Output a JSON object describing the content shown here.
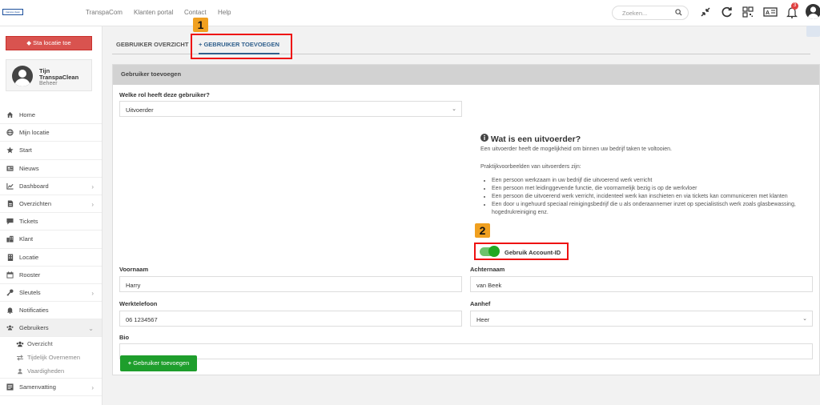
{
  "topbar": {
    "logo_text": "transpa clean",
    "nav": [
      "TranspaCom",
      "Klanten portal",
      "Contact",
      "Help"
    ],
    "search_placeholder": "Zoeken...",
    "notification_count": "3"
  },
  "sidebar": {
    "sta_button": "Sta locatie toe",
    "user": {
      "line1": "Tijn",
      "line2": "TranspaClean",
      "role": "Beheer"
    },
    "items": [
      {
        "label": "Home",
        "icon": "home-icon"
      },
      {
        "label": "Mijn locatie",
        "icon": "globe-icon"
      },
      {
        "label": "Start",
        "icon": "star-icon"
      },
      {
        "label": "Nieuws",
        "icon": "newspaper-icon"
      },
      {
        "label": "Dashboard",
        "icon": "chart-icon",
        "chevron": true
      },
      {
        "label": "Overzichten",
        "icon": "document-icon",
        "chevron": true
      },
      {
        "label": "Tickets",
        "icon": "ticket-icon"
      },
      {
        "label": "Klant",
        "icon": "building-icon"
      },
      {
        "label": "Locatie",
        "icon": "location-building-icon"
      },
      {
        "label": "Rooster",
        "icon": "calendar-icon"
      },
      {
        "label": "Sleutels",
        "icon": "key-icon",
        "chevron": true
      },
      {
        "label": "Notificaties",
        "icon": "bell-icon"
      },
      {
        "label": "Gebruikers",
        "icon": "users-icon",
        "chevron": true,
        "expanded": true
      }
    ],
    "subitems": [
      {
        "label": "Overzicht",
        "icon": "users-icon"
      },
      {
        "label": "Tijdelijk Overnemen",
        "icon": "exchange-icon"
      },
      {
        "label": "Vaardigheden",
        "icon": "users-icon"
      }
    ],
    "last_item": {
      "label": "Samenvatting",
      "icon": "summary-icon"
    }
  },
  "tabs": {
    "overview": "GEBRUIKER OVERZICHT",
    "add": "+ GEBRUIKER TOEVOEGEN"
  },
  "callouts": {
    "one": "1",
    "two": "2"
  },
  "panel": {
    "title": "Gebruiker toevoegen",
    "role_label": "Welke rol heeft deze gebruiker?",
    "role_value": "Uitvoerder",
    "info_title": "Wat is een uitvoerder?",
    "info_intro": "Een uitvoerder heeft de mogelijkheid om binnen uw bedrijf taken te voltooien.",
    "examples_title": "Praktijkvoorbeelden van uitvoerders zijn:",
    "examples": [
      "Een persoon werkzaam in uw bedrijf die uitvoerend werk verricht",
      "Een persoon met leidinggevende functie, die voornamelijk bezig is op de werkvloer",
      "Een persoon die uitvoerend werk verricht, incidenteel werk kan inschieten en via tickets kan communiceren met klanten",
      "Een door u ingehuurd speciaal reinigingsbedrijf die u als onderaannemer inzet op specialistisch werk zoals glasbewassing, hogedrukreiniging enz."
    ],
    "toggle_label": "Gebruik Account-ID",
    "toggle_on": true,
    "firstname_label": "Voornaam",
    "firstname_value": "Harry",
    "lastname_label": "Achternaam",
    "lastname_value": "van Beek",
    "phone_label": "Werktelefoon",
    "phone_value": "06 1234567",
    "salutation_label": "Aanhef",
    "salutation_value": "Heer",
    "bio_label": "Bio",
    "bio_value": "",
    "submit_label": "Gebruiker toevoegen",
    "submit_icon": "plus-icon"
  },
  "colors": {
    "accent": "#2f5f8c",
    "danger": "#d9534f",
    "success": "#1e9e2c",
    "callout": "#f0a020",
    "highlight": "#e11111"
  }
}
